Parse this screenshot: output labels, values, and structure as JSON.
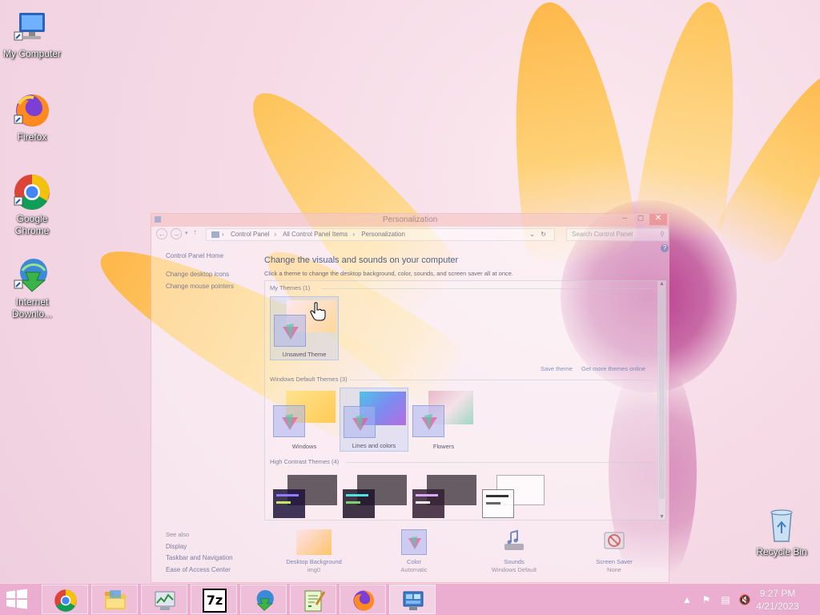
{
  "desktop": {
    "icons": [
      {
        "label": "My Computer"
      },
      {
        "label": "Firefox"
      },
      {
        "label": "Google Chrome"
      },
      {
        "label": "Internet Downlo..."
      },
      {
        "label": "Recycle Bin"
      }
    ]
  },
  "window": {
    "title": "Personalization",
    "address": {
      "crumbs": [
        "Control Panel",
        "All Control Panel Items",
        "Personalization"
      ]
    },
    "search_placeholder": "Search Control Panel",
    "left_links": [
      "Control Panel Home",
      "Change desktop icons",
      "Change mouse pointers"
    ],
    "heading": "Change the visuals and sounds on your computer",
    "subheading": "Click a theme to change the desktop background, color, sounds, and screen saver all at once.",
    "my_themes": {
      "label": "My Themes (1)",
      "items": [
        {
          "label": "Unsaved Theme"
        }
      ]
    },
    "links": {
      "save_theme": "Save theme",
      "get_more": "Get more themes online"
    },
    "default_themes": {
      "label": "Windows Default Themes (3)",
      "items": [
        {
          "label": "Windows"
        },
        {
          "label": "Lines and colors"
        },
        {
          "label": "Flowers"
        }
      ]
    },
    "high_contrast": {
      "label": "High Contrast Themes (4)"
    },
    "see_also": {
      "label": "See also",
      "items": [
        "Display",
        "Taskbar and Navigation",
        "Ease of Access Center"
      ]
    },
    "bottom": [
      {
        "label": "Desktop Background",
        "value": "img0"
      },
      {
        "label": "Color",
        "value": "Automatic"
      },
      {
        "label": "Sounds",
        "value": "Windows Default"
      },
      {
        "label": "Screen Saver",
        "value": "None"
      }
    ],
    "help_glyph": "?"
  },
  "taskbar": {
    "clock": {
      "time": "9:27 PM",
      "date": "4/21/2023"
    },
    "apps": [
      "chrome-icon",
      "file-explorer-icon",
      "task-manager-icon",
      "7zip-icon",
      "internet-download-manager-icon",
      "notepad-plus-plus-icon",
      "firefox-icon",
      "control-panel-icon"
    ],
    "sevenzip_text": "7z"
  },
  "colors": {
    "taskbar": "#e8a0c8",
    "wallpaper": "#f6dbe6",
    "petal": "#ffb43a"
  }
}
